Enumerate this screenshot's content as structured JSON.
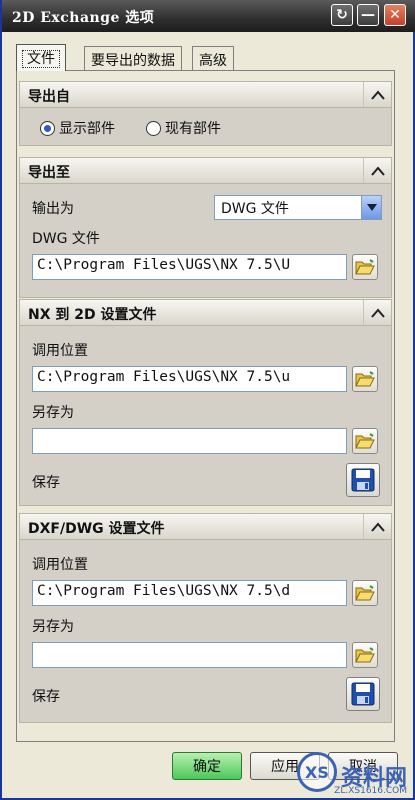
{
  "window": {
    "title": "2D Exchange 选项",
    "controls": {
      "help": "↻",
      "minimize": "—",
      "close": "✕"
    }
  },
  "tabs": [
    {
      "label": "文件",
      "active": true
    },
    {
      "label": "要导出的数据",
      "active": false
    },
    {
      "label": "高级",
      "active": false
    }
  ],
  "export_from": {
    "header": "导出自",
    "options": [
      {
        "label": "显示部件",
        "selected": true
      },
      {
        "label": "现有部件",
        "selected": false
      }
    ]
  },
  "export_to": {
    "header": "导出至",
    "output_label": "输出为",
    "output_value": "DWG 文件",
    "file_label": "DWG 文件",
    "file_path": "C:\\Program Files\\UGS\\NX 7.5\\U"
  },
  "nx_to_2d": {
    "header": "NX 到 2D 设置文件",
    "location_label": "调用位置",
    "location_path": "C:\\Program Files\\UGS\\NX 7.5\\u",
    "save_as_label": "另存为",
    "save_as_value": "",
    "save_label": "保存"
  },
  "dxf_dwg": {
    "header": "DXF/DWG 设置文件",
    "location_label": "调用位置",
    "location_path": "C:\\Program Files\\UGS\\NX 7.5\\d",
    "save_as_label": "另存为",
    "save_as_value": "",
    "save_label": "保存"
  },
  "buttons": {
    "ok": "确定",
    "apply": "应用",
    "cancel": "取消"
  },
  "watermark": {
    "text": "资料网",
    "url": "ZL.XS1616.COM"
  },
  "colors": {
    "accent": "#2a5bc7",
    "ok_button": "#4cc85a",
    "titlebar": "#2f2f2f"
  }
}
